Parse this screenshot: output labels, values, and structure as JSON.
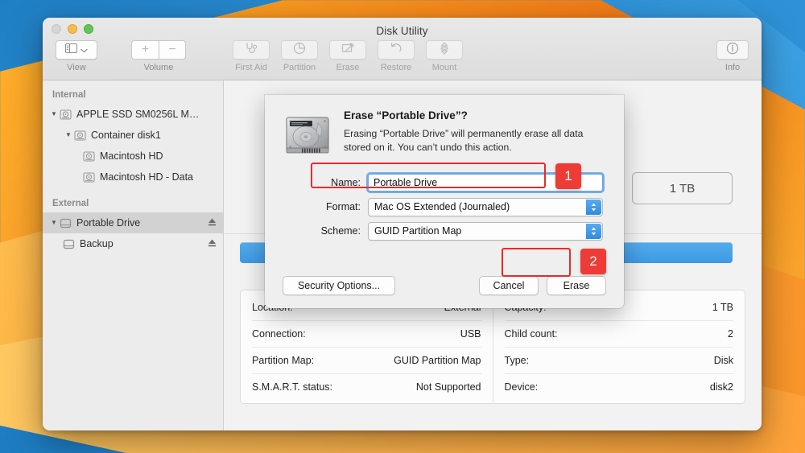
{
  "window": {
    "title": "Disk Utility",
    "traffic_lights": [
      "close-button",
      "minimize-button",
      "zoom-button"
    ]
  },
  "toolbar": {
    "view": {
      "label": "View",
      "icon": "sidebar-icon",
      "chevron": "chevron-down-icon"
    },
    "volume": {
      "label": "Volume",
      "add": "+",
      "remove": "−"
    },
    "actions": [
      {
        "label": "First Aid",
        "icon": "stethoscope-icon",
        "enabled": false
      },
      {
        "label": "Partition",
        "icon": "pie-chart-icon",
        "enabled": false
      },
      {
        "label": "Erase",
        "icon": "erase-pencil-icon",
        "enabled": false
      },
      {
        "label": "Restore",
        "icon": "undo-arrow-icon",
        "enabled": false
      },
      {
        "label": "Mount",
        "icon": "mount-icon",
        "enabled": false
      }
    ],
    "info": {
      "label": "Info",
      "icon": "info-circle-icon"
    }
  },
  "sidebar": {
    "sections": [
      {
        "header": "Internal",
        "items": [
          {
            "label": "APPLE SSD SM0256L M…",
            "indent": 0,
            "disclosure": "▼",
            "icon": "internal-disk-icon",
            "selected": false,
            "eject": false
          },
          {
            "label": "Container disk1",
            "indent": 1,
            "disclosure": "▼",
            "icon": "internal-disk-icon",
            "selected": false,
            "eject": false
          },
          {
            "label": "Macintosh HD",
            "indent": 2,
            "disclosure": "",
            "icon": "volume-icon",
            "selected": false,
            "eject": false
          },
          {
            "label": "Macintosh HD - Data",
            "indent": 2,
            "disclosure": "",
            "icon": "volume-icon",
            "selected": false,
            "eject": false
          }
        ]
      },
      {
        "header": "External",
        "items": [
          {
            "label": "Portable Drive",
            "indent": 0,
            "disclosure": "▼",
            "icon": "external-disk-icon",
            "selected": true,
            "eject": true
          },
          {
            "label": "Backup",
            "indent": 1,
            "disclosure": "",
            "icon": "external-volume-icon",
            "selected": false,
            "eject": true
          }
        ]
      }
    ]
  },
  "main": {
    "capacity_badge": "1 TB",
    "usage_bar_color": "#3d9ae4",
    "info": {
      "left": [
        {
          "label": "Location:",
          "value": "External"
        },
        {
          "label": "Connection:",
          "value": "USB"
        },
        {
          "label": "Partition Map:",
          "value": "GUID Partition Map"
        },
        {
          "label": "S.M.A.R.T. status:",
          "value": "Not Supported"
        }
      ],
      "right": [
        {
          "label": "Capacity:",
          "value": "1 TB"
        },
        {
          "label": "Child count:",
          "value": "2"
        },
        {
          "label": "Type:",
          "value": "Disk"
        },
        {
          "label": "Device:",
          "value": "disk2"
        }
      ]
    }
  },
  "dialog": {
    "icon": "hard-drive-icon",
    "title": "Erase “Portable Drive”?",
    "description": "Erasing “Portable Drive” will permanently erase all data stored on it. You can’t undo this action.",
    "fields": [
      {
        "label": "Name:",
        "type": "text",
        "value": "Portable Drive",
        "focused": true
      },
      {
        "label": "Format:",
        "type": "popup",
        "value": "Mac OS Extended (Journaled)"
      },
      {
        "label": "Scheme:",
        "type": "popup",
        "value": "GUID Partition Map"
      }
    ],
    "buttons": {
      "security": "Security Options...",
      "cancel": "Cancel",
      "erase": "Erase"
    }
  },
  "annotations": {
    "color": "#ec2a2a",
    "badges": [
      {
        "number": "1",
        "target": "name-field"
      },
      {
        "number": "2",
        "target": "erase-button"
      }
    ]
  }
}
